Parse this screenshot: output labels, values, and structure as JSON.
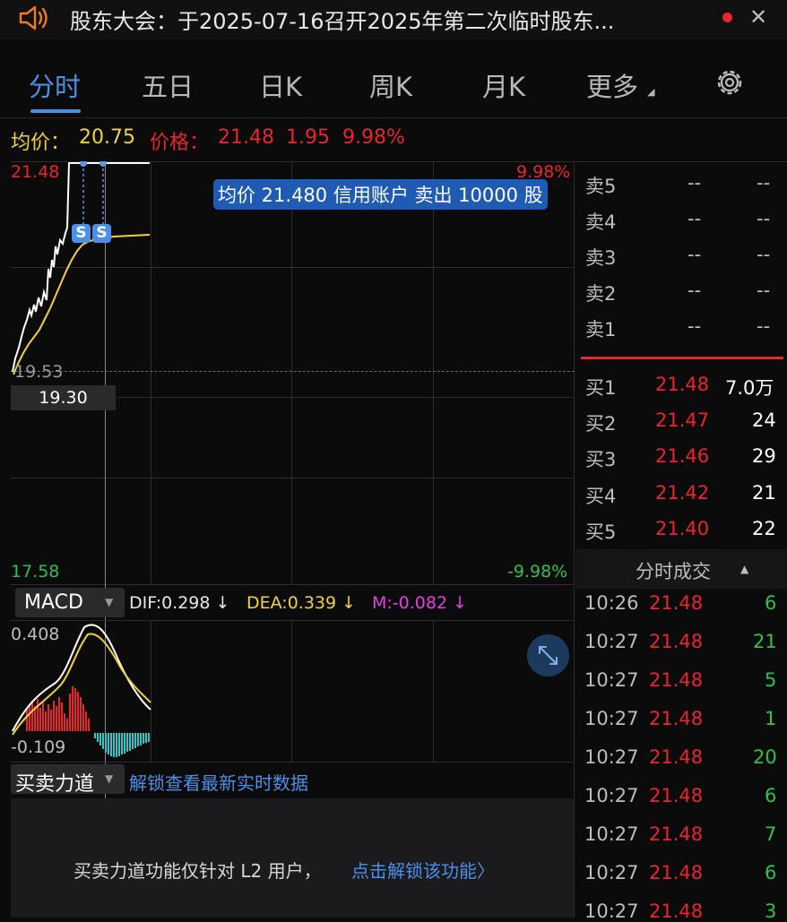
{
  "notice": {
    "text": "股东大会：于2025-07-16召开2025年第二次临时股东...",
    "close": "✕"
  },
  "tabs": [
    {
      "label": "分时",
      "active": true
    },
    {
      "label": "五日"
    },
    {
      "label": "日K"
    },
    {
      "label": "周K"
    },
    {
      "label": "月K"
    },
    {
      "label": "更多"
    }
  ],
  "more_caret": "◢",
  "info": {
    "avg_label": "均价：",
    "avg_value": "20.75",
    "price_label": "价格：",
    "price_value": "21.48",
    "change": "1.95",
    "change_pct": "9.98%"
  },
  "chart": {
    "high_label": "21.48",
    "high_pct": "9.98%",
    "prev_close": "19.53",
    "cursor_price": "19.30",
    "low_label": "17.58",
    "low_pct": "-9.98%",
    "tooltip": "均价 21.480 信用账户 卖出 10000 股",
    "marker": "S"
  },
  "macd": {
    "selector": "MACD",
    "caret": "▼",
    "dif": "DIF:0.298 ↓",
    "dea": "DEA:0.339 ↓",
    "m": "M:-0.082 ↓",
    "top": "0.408",
    "bottom": "-0.109"
  },
  "power": {
    "selector": "买卖力道",
    "caret": "▼",
    "unlock_link": "解锁查看最新实时数据",
    "notice_text": "买卖力道功能仅针对 L2 用户，",
    "notice_link": "点击解锁该功能〉"
  },
  "order_book": {
    "asks": [
      {
        "label": "卖5",
        "price": "--",
        "vol": "--"
      },
      {
        "label": "卖4",
        "price": "--",
        "vol": "--"
      },
      {
        "label": "卖3",
        "price": "--",
        "vol": "--"
      },
      {
        "label": "卖2",
        "price": "--",
        "vol": "--"
      },
      {
        "label": "卖1",
        "price": "--",
        "vol": "--"
      }
    ],
    "bids": [
      {
        "label": "买1",
        "price": "21.48",
        "vol": "7.0万"
      },
      {
        "label": "买2",
        "price": "21.47",
        "vol": "24"
      },
      {
        "label": "买3",
        "price": "21.46",
        "vol": "29"
      },
      {
        "label": "买4",
        "price": "21.42",
        "vol": "21"
      },
      {
        "label": "买5",
        "price": "21.40",
        "vol": "22"
      }
    ]
  },
  "trades": {
    "title": "分时成交",
    "caret": "▲",
    "rows": [
      {
        "time": "10:26",
        "price": "21.48",
        "vol": "6"
      },
      {
        "time": "10:27",
        "price": "21.48",
        "vol": "21"
      },
      {
        "time": "10:27",
        "price": "21.48",
        "vol": "5"
      },
      {
        "time": "10:27",
        "price": "21.48",
        "vol": "1"
      },
      {
        "time": "10:27",
        "price": "21.48",
        "vol": "20"
      },
      {
        "time": "10:27",
        "price": "21.48",
        "vol": "6"
      },
      {
        "time": "10:27",
        "price": "21.48",
        "vol": "7"
      },
      {
        "time": "10:27",
        "price": "21.48",
        "vol": "6"
      },
      {
        "time": "10:27",
        "price": "21.48",
        "vol": "3"
      }
    ]
  },
  "colors": {
    "accent": "#4a8fe8",
    "up": "#e8262b",
    "down": "#2fc24a",
    "avg": "#f2d13a",
    "magenta": "#e040e0",
    "cyan": "#2ec8c8"
  }
}
